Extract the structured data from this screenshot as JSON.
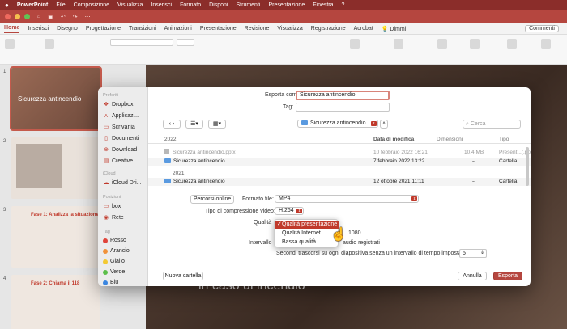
{
  "menubar": {
    "app": "PowerPoint",
    "items": [
      "File",
      "Composizione",
      "Visualizza",
      "Inserisci",
      "Formato",
      "Disponi",
      "Strumenti",
      "Presentazione",
      "Finestra",
      "?"
    ]
  },
  "ribbon": {
    "tabs": [
      "Home",
      "Inserisci",
      "Disegno",
      "Progettazione",
      "Transizioni",
      "Animazioni",
      "Presentazione",
      "Revisione",
      "Visualizza",
      "Registrazione",
      "Acrobat"
    ],
    "tell_me": "Dimmi",
    "comments": "Commenti"
  },
  "slides": {
    "thumb1_title": "Sicurezza antincendio",
    "thumb3_title": "Fase 1: Analizza la situazione",
    "thumb4_title": "Fase 2: Chiama il 118",
    "numbers": [
      "1",
      "2",
      "3",
      "4"
    ],
    "main_text": "in caso di incendio"
  },
  "sidebar": {
    "favorites_header": "Preferiti",
    "favorites": [
      "Dropbox",
      "Applicazi...",
      "Scrivania",
      "Documenti",
      "Download",
      "Creative..."
    ],
    "icloud_header": "iCloud",
    "icloud": [
      "iCloud Dri..."
    ],
    "locations_header": "Posizioni",
    "locations": [
      "box",
      "Rete"
    ],
    "tags_header": "Tag",
    "tags": [
      {
        "name": "Rosso",
        "color": "#e0443a"
      },
      {
        "name": "Arancio",
        "color": "#f0923a"
      },
      {
        "name": "Giallo",
        "color": "#f3c932"
      },
      {
        "name": "Verde",
        "color": "#5cbf4a"
      },
      {
        "name": "Blu",
        "color": "#3a86e0"
      }
    ]
  },
  "dialog": {
    "export_as_label": "Esporta come:",
    "export_as_value": "Sicurezza antincendio",
    "tag_label": "Tag:",
    "location": "Sicurezza antincendio",
    "search_placeholder": "Cerca",
    "columns": {
      "date": "Data di modifica",
      "size": "Dimensioni",
      "type": "Tipo"
    },
    "group_2022": "2022",
    "group_2021": "2021",
    "files": [
      {
        "name": "Sicurezza antincendio.pptx",
        "date": "10 febbraio 2022 16:21",
        "size": "10,4 MB",
        "type": "Present...(.pptx)",
        "kind": "file"
      },
      {
        "name": "Sicurezza antincendio",
        "date": "7 febbraio 2022 13:22",
        "size": "--",
        "type": "Cartella",
        "kind": "folder"
      },
      {
        "name": "Sicurezza antincendio",
        "date": "12 ottobre 2021 11:11",
        "size": "--",
        "type": "Cartella",
        "kind": "folder"
      }
    ],
    "online_locations_button": "Percorsi online",
    "format_label": "Formato file:",
    "format_value": "MP4",
    "compression_label": "Tipo di compressione video:",
    "compression_value": "H.264",
    "quality_label": "Qualità",
    "quality_options": [
      "Qualità presentazione",
      "Qualità Internet",
      "Bassa qualità"
    ],
    "resolution_value": "1080",
    "interval_label": "Intervallo",
    "recorded_audio_label": "audio registrati",
    "seconds_label": "Secondi trascorsi su ogni diapositiva senza un intervallo di tempo impostato:",
    "seconds_value": "5",
    "new_folder_button": "Nuova cartella",
    "cancel_button": "Annulla",
    "export_button": "Esporta"
  },
  "colors": {
    "accent": "#b5463f",
    "menubar": "#8b2d2a"
  }
}
